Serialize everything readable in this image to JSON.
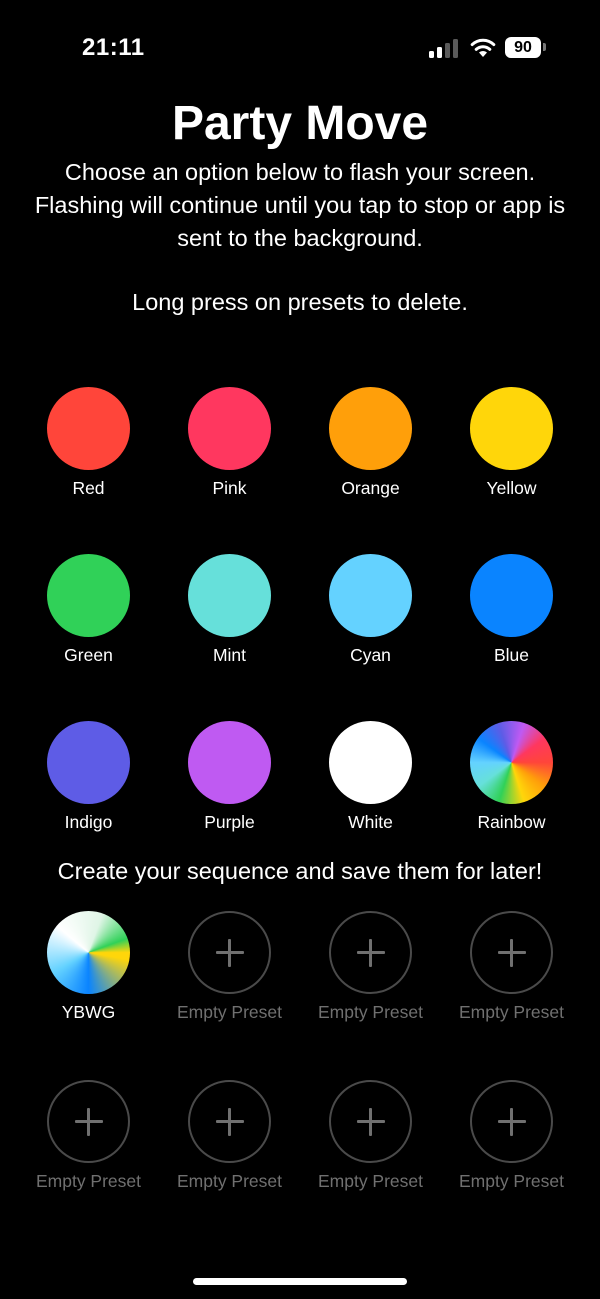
{
  "status_bar": {
    "time": "21:11",
    "battery": "90"
  },
  "header": {
    "title": "Party Move",
    "description": "Choose an option below to flash your screen. Flashing will continue until you tap to stop or app is sent to the background.",
    "hint": "Long press on presets to delete."
  },
  "colors": [
    {
      "label": "Red",
      "color": "#FF453A",
      "icon": ""
    },
    {
      "label": "Pink",
      "color": "#FF375F",
      "icon": ""
    },
    {
      "label": "Orange",
      "color": "#FF9F0A",
      "icon": ""
    },
    {
      "label": "Yellow",
      "color": "#FFD60A",
      "icon": ""
    },
    {
      "label": "Green",
      "color": "#30D158",
      "icon": ""
    },
    {
      "label": "Mint",
      "color": "#66E0DA",
      "icon": ""
    },
    {
      "label": "Cyan",
      "color": "#64D2FF",
      "icon": ""
    },
    {
      "label": "Blue",
      "color": "#0A84FF",
      "icon": ""
    },
    {
      "label": "Indigo",
      "color": "#5E5CE6",
      "icon": ""
    },
    {
      "label": "Purple",
      "color": "#BF5AF2",
      "icon": ""
    },
    {
      "label": "White",
      "color": "#FFFFFF",
      "icon": ""
    },
    {
      "label": "Rainbow",
      "color": "conic",
      "icon": "rainbow-gradient"
    }
  ],
  "sequence_section": {
    "title": "Create your sequence and save them for later!",
    "presets": [
      {
        "label": "YBWG",
        "filled": true,
        "colors": [
          "#FFD60A",
          "#0A84FF",
          "#FFFFFF",
          "#30D158"
        ]
      },
      {
        "label": "Empty Preset",
        "filled": false
      },
      {
        "label": "Empty Preset",
        "filled": false
      },
      {
        "label": "Empty Preset",
        "filled": false
      },
      {
        "label": "Empty Preset",
        "filled": false
      },
      {
        "label": "Empty Preset",
        "filled": false
      },
      {
        "label": "Empty Preset",
        "filled": false
      },
      {
        "label": "Empty Preset",
        "filled": false
      }
    ]
  }
}
